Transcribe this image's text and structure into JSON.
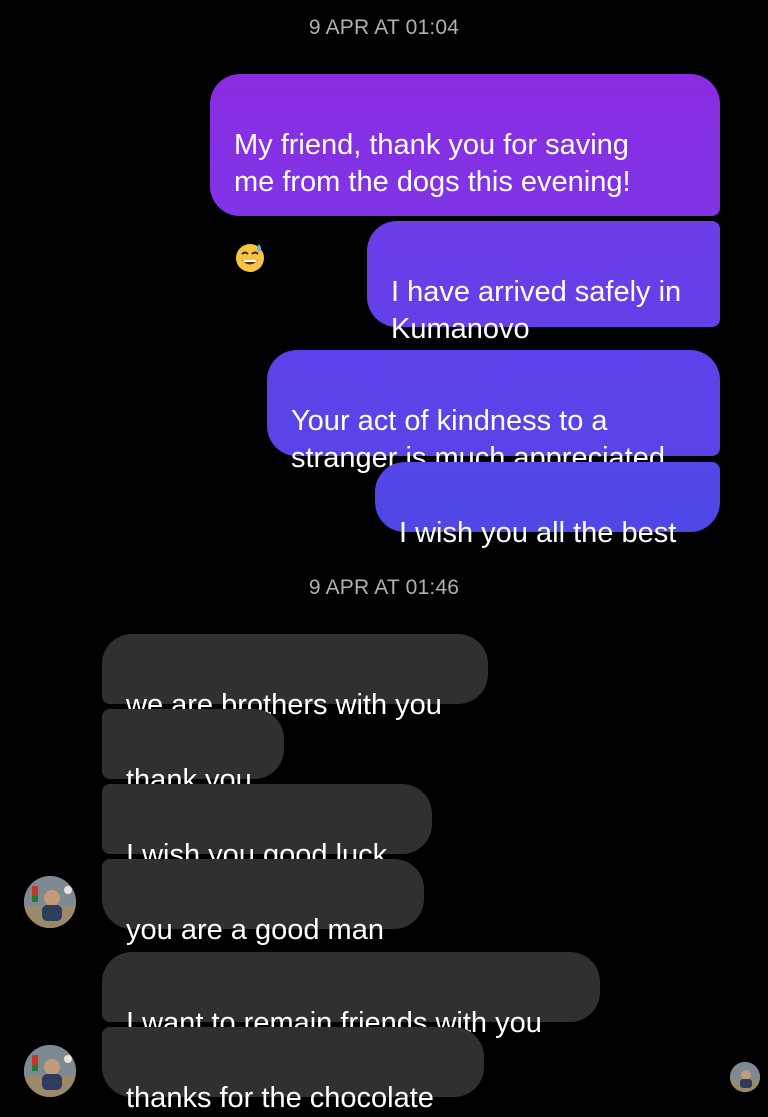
{
  "timestamps": [
    "9 APR AT 01:04",
    "9 APR AT 01:46"
  ],
  "outgoing": [
    {
      "text": "My friend, thank you for saving\nme from the dogs this evening!",
      "emoji": "grinning-face-with-sweat"
    },
    {
      "text": "I have arrived safely in\nKumanovo"
    },
    {
      "text": "Your act of kindness to a\nstranger is much appreciated"
    },
    {
      "text": "I wish you all the best"
    }
  ],
  "incoming": [
    {
      "text": "we are brothers with you"
    },
    {
      "text": "thank you"
    },
    {
      "text": "I wish you good luck"
    },
    {
      "text": "you are a good man"
    },
    {
      "text": "I want to remain friends with you"
    },
    {
      "text": "thanks for the chocolate"
    }
  ],
  "colors": {
    "background": "#000000",
    "outgoing_top": "#8a2be2",
    "outgoing_bottom": "#4f46e5",
    "incoming": "#303030",
    "timestamp": "#b0b0b0"
  },
  "icons": {
    "contact_avatar": "contact-avatar-photo",
    "seen_indicator": "seen-avatar-icon"
  }
}
